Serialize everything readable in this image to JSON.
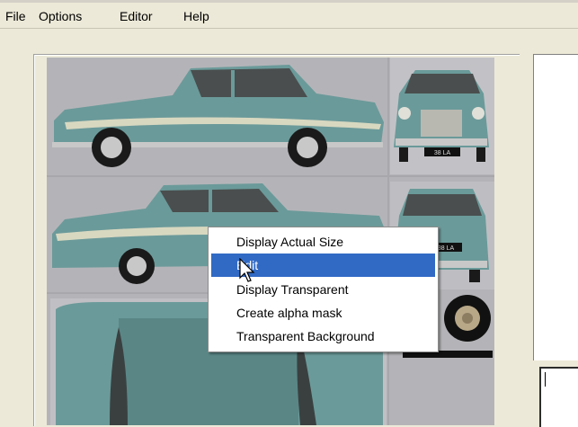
{
  "menubar": {
    "items": [
      {
        "label": "File"
      },
      {
        "label": "Options"
      },
      {
        "label": "Editor"
      },
      {
        "label": "Help"
      }
    ]
  },
  "context_menu": {
    "items": [
      {
        "label": "Display Actual Size",
        "highlighted": false
      },
      {
        "label": "Edit",
        "highlighted": true
      },
      {
        "label": "Display Transparent",
        "highlighted": false
      },
      {
        "label": "Create alpha mask",
        "highlighted": false
      },
      {
        "label": "Transparent Background",
        "highlighted": false
      }
    ]
  },
  "sprite_sheet": {
    "car_plate_text": "38 LA",
    "colors": {
      "body": "#6b9a9a",
      "body_dark": "#4f7878",
      "stripe": "#d8d8c0",
      "background": "#b8b8bc",
      "tire": "#1a1a1a",
      "chrome": "#c8c8c8"
    }
  },
  "colors": {
    "selection": "#316ac5",
    "window_bg": "#ece9d8"
  },
  "editor": {
    "text_value": ""
  }
}
